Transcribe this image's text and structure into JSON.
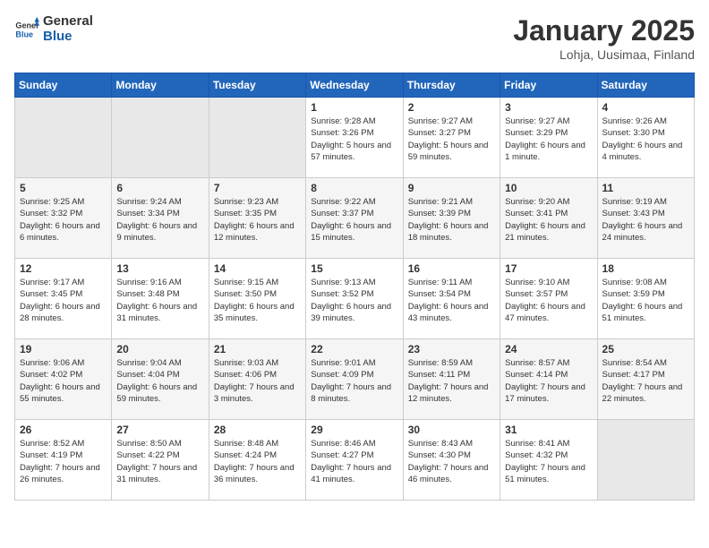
{
  "logo": {
    "general": "General",
    "blue": "Blue"
  },
  "title": "January 2025",
  "subtitle": "Lohja, Uusimaa, Finland",
  "days_of_week": [
    "Sunday",
    "Monday",
    "Tuesday",
    "Wednesday",
    "Thursday",
    "Friday",
    "Saturday"
  ],
  "weeks": [
    [
      {
        "day": "",
        "info": ""
      },
      {
        "day": "",
        "info": ""
      },
      {
        "day": "",
        "info": ""
      },
      {
        "day": "1",
        "info": "Sunrise: 9:28 AM\nSunset: 3:26 PM\nDaylight: 5 hours and 57 minutes."
      },
      {
        "day": "2",
        "info": "Sunrise: 9:27 AM\nSunset: 3:27 PM\nDaylight: 5 hours and 59 minutes."
      },
      {
        "day": "3",
        "info": "Sunrise: 9:27 AM\nSunset: 3:29 PM\nDaylight: 6 hours and 1 minute."
      },
      {
        "day": "4",
        "info": "Sunrise: 9:26 AM\nSunset: 3:30 PM\nDaylight: 6 hours and 4 minutes."
      }
    ],
    [
      {
        "day": "5",
        "info": "Sunrise: 9:25 AM\nSunset: 3:32 PM\nDaylight: 6 hours and 6 minutes."
      },
      {
        "day": "6",
        "info": "Sunrise: 9:24 AM\nSunset: 3:34 PM\nDaylight: 6 hours and 9 minutes."
      },
      {
        "day": "7",
        "info": "Sunrise: 9:23 AM\nSunset: 3:35 PM\nDaylight: 6 hours and 12 minutes."
      },
      {
        "day": "8",
        "info": "Sunrise: 9:22 AM\nSunset: 3:37 PM\nDaylight: 6 hours and 15 minutes."
      },
      {
        "day": "9",
        "info": "Sunrise: 9:21 AM\nSunset: 3:39 PM\nDaylight: 6 hours and 18 minutes."
      },
      {
        "day": "10",
        "info": "Sunrise: 9:20 AM\nSunset: 3:41 PM\nDaylight: 6 hours and 21 minutes."
      },
      {
        "day": "11",
        "info": "Sunrise: 9:19 AM\nSunset: 3:43 PM\nDaylight: 6 hours and 24 minutes."
      }
    ],
    [
      {
        "day": "12",
        "info": "Sunrise: 9:17 AM\nSunset: 3:45 PM\nDaylight: 6 hours and 28 minutes."
      },
      {
        "day": "13",
        "info": "Sunrise: 9:16 AM\nSunset: 3:48 PM\nDaylight: 6 hours and 31 minutes."
      },
      {
        "day": "14",
        "info": "Sunrise: 9:15 AM\nSunset: 3:50 PM\nDaylight: 6 hours and 35 minutes."
      },
      {
        "day": "15",
        "info": "Sunrise: 9:13 AM\nSunset: 3:52 PM\nDaylight: 6 hours and 39 minutes."
      },
      {
        "day": "16",
        "info": "Sunrise: 9:11 AM\nSunset: 3:54 PM\nDaylight: 6 hours and 43 minutes."
      },
      {
        "day": "17",
        "info": "Sunrise: 9:10 AM\nSunset: 3:57 PM\nDaylight: 6 hours and 47 minutes."
      },
      {
        "day": "18",
        "info": "Sunrise: 9:08 AM\nSunset: 3:59 PM\nDaylight: 6 hours and 51 minutes."
      }
    ],
    [
      {
        "day": "19",
        "info": "Sunrise: 9:06 AM\nSunset: 4:02 PM\nDaylight: 6 hours and 55 minutes."
      },
      {
        "day": "20",
        "info": "Sunrise: 9:04 AM\nSunset: 4:04 PM\nDaylight: 6 hours and 59 minutes."
      },
      {
        "day": "21",
        "info": "Sunrise: 9:03 AM\nSunset: 4:06 PM\nDaylight: 7 hours and 3 minutes."
      },
      {
        "day": "22",
        "info": "Sunrise: 9:01 AM\nSunset: 4:09 PM\nDaylight: 7 hours and 8 minutes."
      },
      {
        "day": "23",
        "info": "Sunrise: 8:59 AM\nSunset: 4:11 PM\nDaylight: 7 hours and 12 minutes."
      },
      {
        "day": "24",
        "info": "Sunrise: 8:57 AM\nSunset: 4:14 PM\nDaylight: 7 hours and 17 minutes."
      },
      {
        "day": "25",
        "info": "Sunrise: 8:54 AM\nSunset: 4:17 PM\nDaylight: 7 hours and 22 minutes."
      }
    ],
    [
      {
        "day": "26",
        "info": "Sunrise: 8:52 AM\nSunset: 4:19 PM\nDaylight: 7 hours and 26 minutes."
      },
      {
        "day": "27",
        "info": "Sunrise: 8:50 AM\nSunset: 4:22 PM\nDaylight: 7 hours and 31 minutes."
      },
      {
        "day": "28",
        "info": "Sunrise: 8:48 AM\nSunset: 4:24 PM\nDaylight: 7 hours and 36 minutes."
      },
      {
        "day": "29",
        "info": "Sunrise: 8:46 AM\nSunset: 4:27 PM\nDaylight: 7 hours and 41 minutes."
      },
      {
        "day": "30",
        "info": "Sunrise: 8:43 AM\nSunset: 4:30 PM\nDaylight: 7 hours and 46 minutes."
      },
      {
        "day": "31",
        "info": "Sunrise: 8:41 AM\nSunset: 4:32 PM\nDaylight: 7 hours and 51 minutes."
      },
      {
        "day": "",
        "info": ""
      }
    ]
  ]
}
